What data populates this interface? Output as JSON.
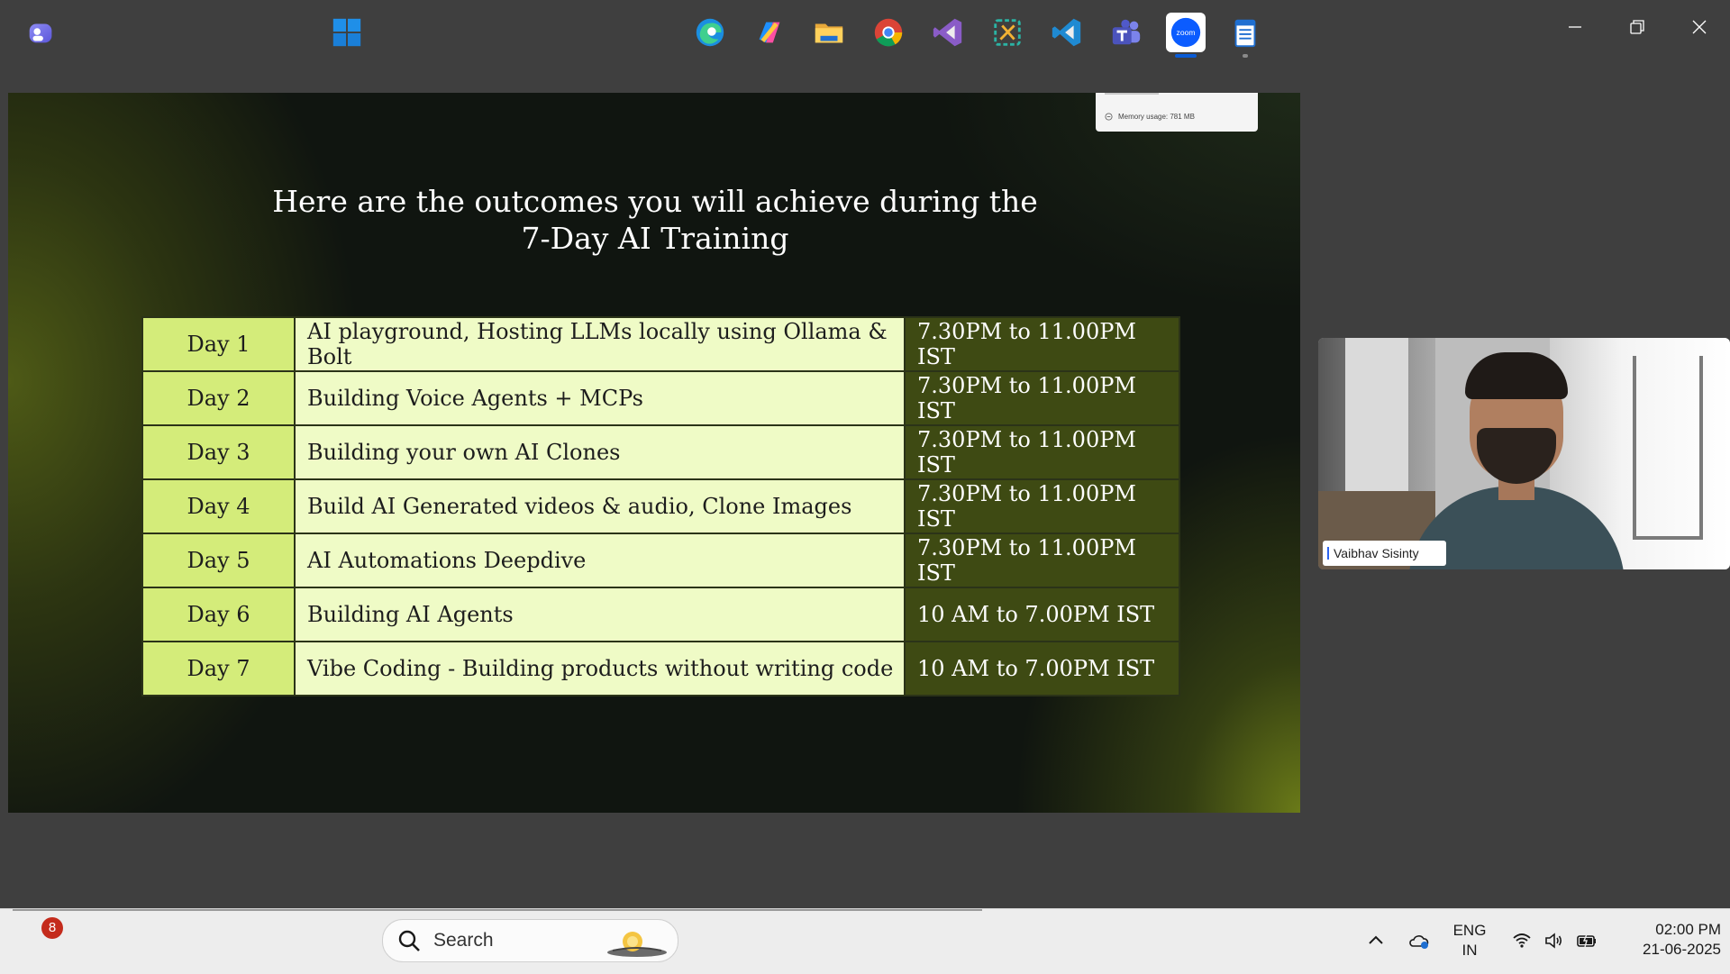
{
  "window": {
    "controls": [
      "minimize-icon",
      "restore-icon",
      "close-icon"
    ]
  },
  "slide": {
    "title_line1": "Here are the outcomes you will achieve during the",
    "title_line2": "7-Day AI Training",
    "memory_popup": "Memory usage: 781 MB",
    "table": [
      {
        "day": "Day 1",
        "topic": "AI playground, Hosting LLMs locally using Ollama & Bolt",
        "time": "7.30PM to 11.00PM IST"
      },
      {
        "day": "Day 2",
        "topic": "Building Voice Agents + MCPs",
        "time": "7.30PM to 11.00PM IST"
      },
      {
        "day": "Day 3",
        "topic": "Building your own AI Clones",
        "time": "7.30PM to 11.00PM IST"
      },
      {
        "day": "Day 4",
        "topic": "Build AI Generated videos & audio, Clone Images",
        "time": "7.30PM to 11.00PM IST"
      },
      {
        "day": "Day 5",
        "topic": "AI Automations Deepdive",
        "time": "7.30PM to 11.00PM IST"
      },
      {
        "day": "Day 6",
        "topic": "Building AI Agents",
        "time": "10 AM to 7.00PM IST"
      },
      {
        "day": "Day 7",
        "topic": "Vibe Coding - Building products without writing code",
        "time": "10 AM to 7.00PM IST"
      }
    ],
    "colors": {
      "day_cell": "#d4ec7a",
      "topic_cell": "#effbc6",
      "time_cell": "#3e4a13"
    }
  },
  "video": {
    "participant_name": "Vaibhav Sisinty"
  },
  "taskbar": {
    "notification_count": "8",
    "search_placeholder": "Search",
    "apps": [
      "teams-chat-icon",
      "windows-start-icon",
      "edge-icon",
      "copilot-icon",
      "file-explorer-icon",
      "chrome-icon",
      "visual-studio-icon",
      "snipping-tool-icon",
      "vscode-icon",
      "teams-icon",
      "zoom-icon",
      "notepad-icon"
    ],
    "active_app": "zoom-icon",
    "language_line1": "ENG",
    "language_line2": "IN",
    "time": "02:00 PM",
    "date": "21-06-2025"
  }
}
